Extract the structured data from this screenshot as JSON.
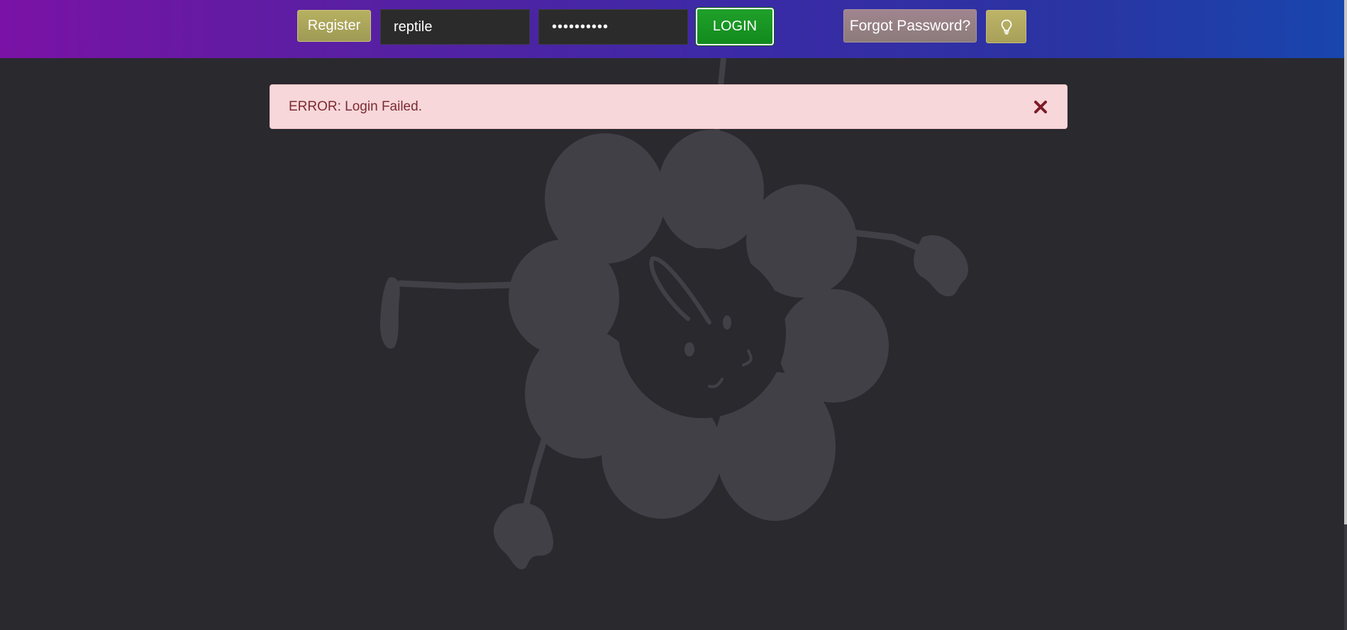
{
  "header": {
    "register_label": "Register",
    "username_value": "reptile",
    "password_value": "••••••••••",
    "login_label": "LOGIN",
    "forgot_label": "Forgot Password?",
    "theme_icon": "lightbulb-icon"
  },
  "alert": {
    "message": "ERROR: Login Failed.",
    "close_icon": "close-icon"
  },
  "background": {
    "illustration": "flower-mascot-illustration"
  },
  "colors": {
    "page_bg": "#29292e",
    "login_green": "#1a9a25",
    "alert_bg": "#f7d7da",
    "alert_text": "#7b2a32",
    "illustration": "#404046"
  }
}
